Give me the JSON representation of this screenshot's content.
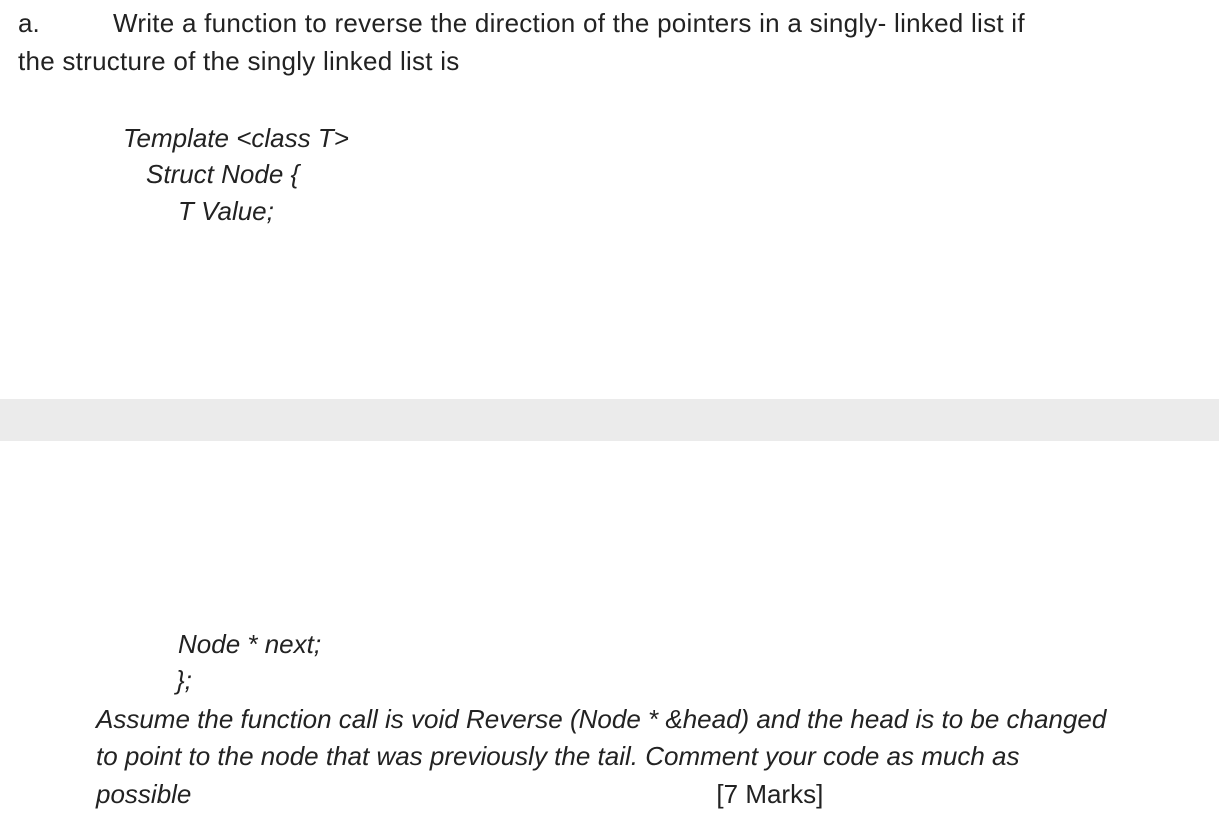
{
  "question": {
    "label": "a.",
    "line1": "Write a function to reverse the direction of the pointers in a singly- linked list if",
    "line2": "the structure of the singly linked list is"
  },
  "code_top": {
    "line1": "Template <class T>",
    "line2": "Struct Node {",
    "line3": "T Value;"
  },
  "code_bottom": {
    "line4": "Node * next;",
    "line5": "};"
  },
  "assume": {
    "line1": "Assume the function call is void Reverse (Node * &head) and the head is to be changed",
    "line2": "to point to the node that was previously the tail. Comment your code as much as",
    "possible": "possible",
    "marks": "[7 Marks]"
  }
}
